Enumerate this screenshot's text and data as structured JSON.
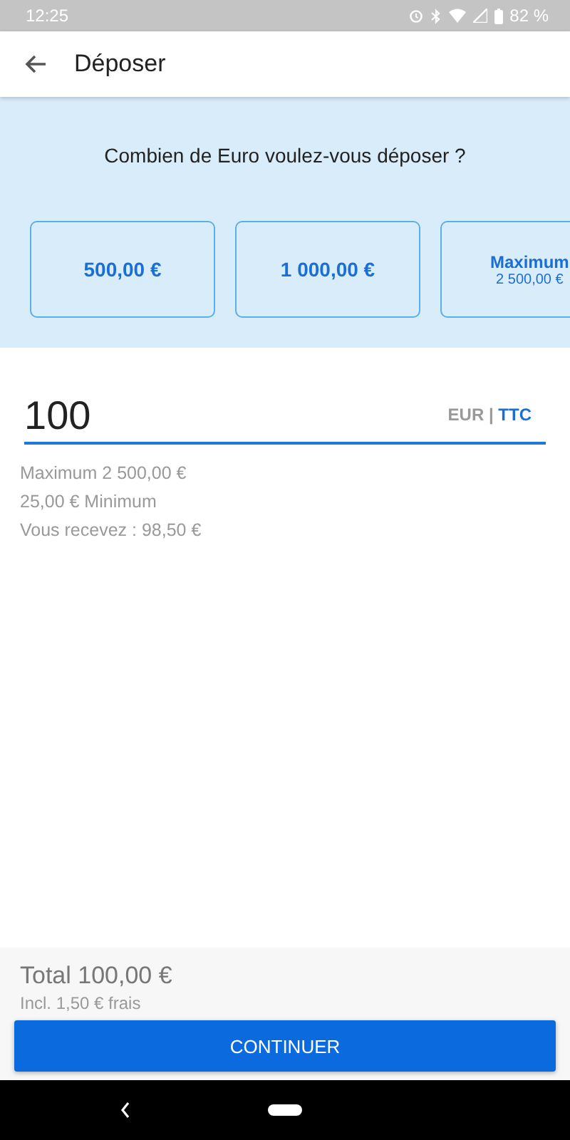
{
  "status_bar": {
    "time": "12:25",
    "battery": "82 %"
  },
  "app_bar": {
    "title": "Déposer"
  },
  "prompt": "Combien de Euro voulez-vous déposer ?",
  "presets": [
    {
      "kind": "amount",
      "label": "500,00 €"
    },
    {
      "kind": "amount",
      "label": "1 000,00 €"
    },
    {
      "kind": "max",
      "label": "Maximum",
      "sublabel": "2 500,00 €"
    }
  ],
  "amount_field": {
    "value": "100",
    "currency": "EUR",
    "separator": "|",
    "tax": "TTC"
  },
  "hints": [
    "Maximum 2 500,00 €",
    "25,00 € Minimum",
    "Vous recevez : 98,50 €"
  ],
  "footer": {
    "total": "Total 100,00 €",
    "fees": "Incl. 1,50 € frais",
    "button": "CONTINUER"
  }
}
